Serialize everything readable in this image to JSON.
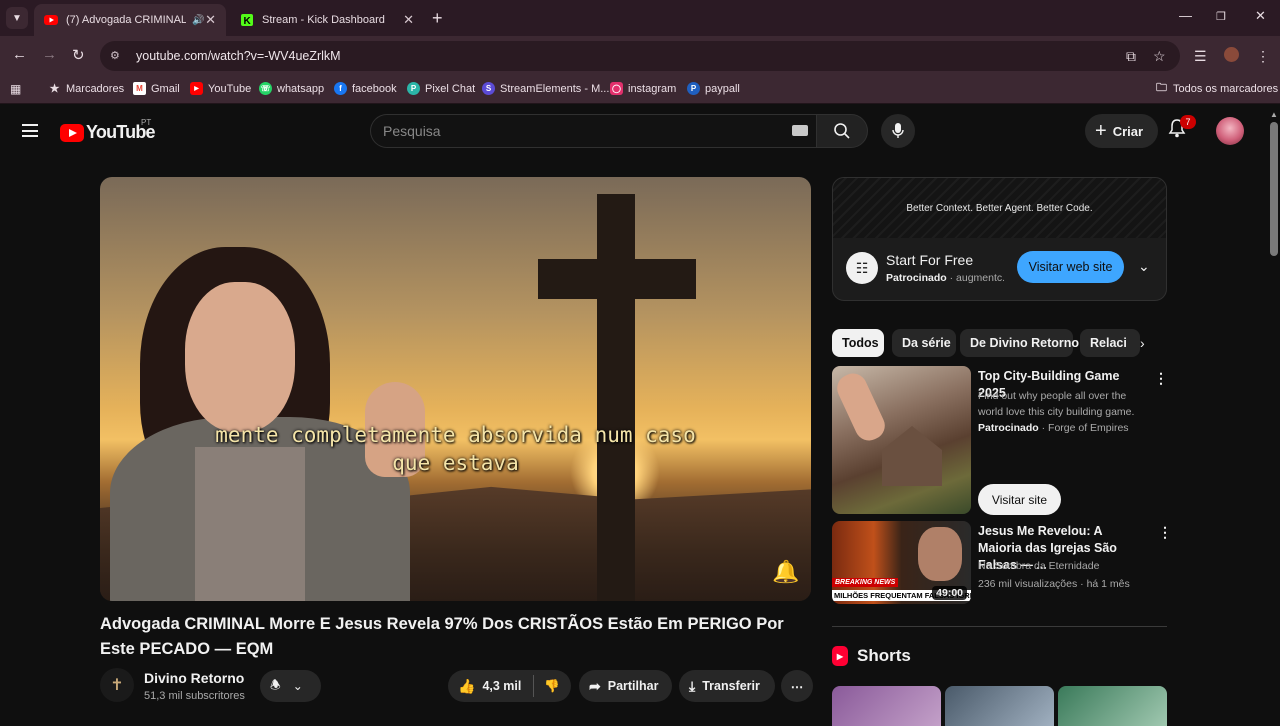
{
  "browser": {
    "tabs": [
      {
        "title": "(7) Advogada CRIMINAL M",
        "favicon": "youtube-icon",
        "active": true
      },
      {
        "title": "Stream - Kick Dashboard",
        "favicon": "kick-icon",
        "active": false
      }
    ],
    "url": "youtube.com/watch?v=-WV4ueZrlkM",
    "bookmarks": [
      {
        "label": "Marcadores",
        "icon": "star-icon",
        "color": "#e8dce2"
      },
      {
        "label": "Gmail",
        "icon": "gmail-icon",
        "color": "#ea4335"
      },
      {
        "label": "YouTube",
        "icon": "youtube-icon",
        "color": "#ff0000"
      },
      {
        "label": "whatsapp",
        "icon": "whatsapp-icon",
        "color": "#25d366"
      },
      {
        "label": "facebook",
        "icon": "facebook-icon",
        "color": "#1877f2"
      },
      {
        "label": "Pixel Chat",
        "icon": "pixelchat-icon",
        "color": "#2bb5a8"
      },
      {
        "label": "StreamElements - M...",
        "icon": "streamelements-icon",
        "color": "#5b4bd6"
      },
      {
        "label": "instagram",
        "icon": "instagram-icon",
        "color": "#e1306c"
      },
      {
        "label": "paypall",
        "icon": "paypal-icon",
        "color": "#1f5fbf"
      }
    ],
    "all_bookmarks": "Todos os marcadores"
  },
  "youtube": {
    "logo_text": "YouTube",
    "country_code": "PT",
    "search_placeholder": "Pesquisa",
    "create_label": "Criar",
    "notification_count": "7"
  },
  "video": {
    "subtitle_line1": "mente completamente absorvida num caso",
    "subtitle_line2": "que estava",
    "title": "Advogada CRIMINAL Morre E Jesus Revela 97% Dos CRISTÃOS Estão Em PERIGO Por Este PECADO — EQM",
    "channel_name": "Divino Retorno",
    "subscribers": "51,3 mil subscritores",
    "likes": "4,3 mil",
    "share_label": "Partilhar",
    "download_label": "Transferir"
  },
  "ad": {
    "banner_text": "Better Context. Better Agent. Better Code.",
    "title": "Start For Free",
    "sponsored_label": "Patrocinado",
    "advertiser": "augmentc...",
    "cta": "Visitar web site"
  },
  "chips": [
    "Todos",
    "Da série",
    "De Divino Retorno",
    "Relaci"
  ],
  "recommendations": [
    {
      "title": "Top City-Building Game 2025",
      "description": "Find out why people all over the world love this city building game.",
      "sponsored_label": "Patrocinado",
      "advertiser": "Forge of Empires",
      "cta": "Visitar site"
    },
    {
      "title": "Jesus Me Revelou: A Maioria das Igrejas São Falsas — ...",
      "channel": "Na Sombra da Eternidade",
      "views": "236 mil visualizações",
      "age": "há 1 mês",
      "duration": "49:00",
      "thumb_badge1": "BREAKING NEWS",
      "thumb_badge2": "MILHÕES FREQUENTAM FALSAS IGREJAS"
    }
  ],
  "shorts": {
    "heading": "Shorts"
  }
}
